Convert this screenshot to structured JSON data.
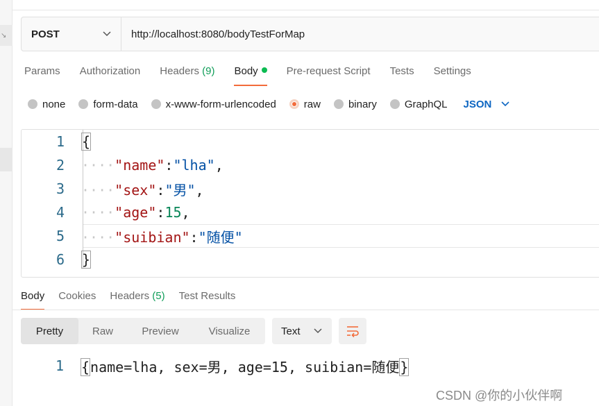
{
  "request": {
    "method": "POST",
    "url": "http://localhost:8080/bodyTestForMap"
  },
  "request_tabs": [
    {
      "label": "Params"
    },
    {
      "label": "Authorization"
    },
    {
      "label": "Headers",
      "count": "(9)"
    },
    {
      "label": "Body"
    },
    {
      "label": "Pre-request Script"
    },
    {
      "label": "Tests"
    },
    {
      "label": "Settings"
    }
  ],
  "body_types": [
    {
      "label": "none"
    },
    {
      "label": "form-data"
    },
    {
      "label": "x-www-form-urlencoded"
    },
    {
      "label": "raw"
    },
    {
      "label": "binary"
    },
    {
      "label": "GraphQL"
    }
  ],
  "body_format": "JSON",
  "editor": {
    "line_numbers": [
      "1",
      "2",
      "3",
      "4",
      "5",
      "6"
    ],
    "open_brace": "{",
    "close_brace": "}",
    "line2": {
      "key": "\"name\"",
      "value": "\"lha\""
    },
    "line3": {
      "key": "\"sex\"",
      "value": "\"男\""
    },
    "line4": {
      "key": "\"age\"",
      "value": "15"
    },
    "line5": {
      "key": "\"suibian\"",
      "value": "\"随便\""
    }
  },
  "response_tabs": [
    {
      "label": "Body"
    },
    {
      "label": "Cookies"
    },
    {
      "label": "Headers",
      "count": "(5)"
    },
    {
      "label": "Test Results"
    }
  ],
  "view_modes": [
    "Pretty",
    "Raw",
    "Preview",
    "Visualize"
  ],
  "response_format": "Text",
  "response": {
    "line_number": "1",
    "open": "{",
    "text": "name=lha, sex=男, age=15, suibian=随便",
    "close": "}"
  },
  "watermark": "CSDN @你的小伙伴啊",
  "colors": {
    "accent": "#f26b3a",
    "json_blue": "#0d66c2",
    "count_green": "#0f9d58"
  }
}
